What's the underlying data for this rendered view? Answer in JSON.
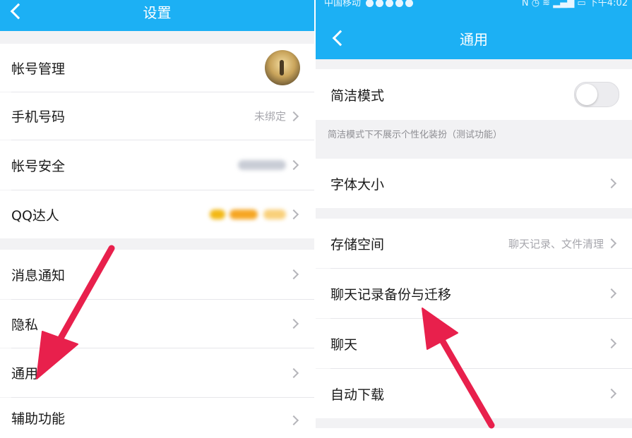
{
  "left": {
    "header_title": "设置",
    "rows": {
      "account_management": "帐号管理",
      "phone_number": {
        "label": "手机号码",
        "value": "未绑定"
      },
      "account_security": "帐号安全",
      "qq_expert": "QQ达人",
      "message_notification": "消息通知",
      "privacy": "隐私",
      "general": "通用",
      "accessibility": "辅助功能"
    }
  },
  "right": {
    "status_bar": {
      "carrier": "中国移动",
      "time": "下午4:02"
    },
    "header_title": "通用",
    "simple_mode": {
      "label": "简洁模式",
      "enabled": false,
      "note": "简洁模式下不展示个性化装扮（测试功能）"
    },
    "font_size": "字体大小",
    "storage": {
      "label": "存储空间",
      "value": "聊天记录、文件清理"
    },
    "chat_backup": "聊天记录备份与迁移",
    "chat": "聊天",
    "auto_download": "自动下载"
  },
  "colors": {
    "header_blue": "#1cb0f4",
    "arrow_red": "#e8204c"
  }
}
